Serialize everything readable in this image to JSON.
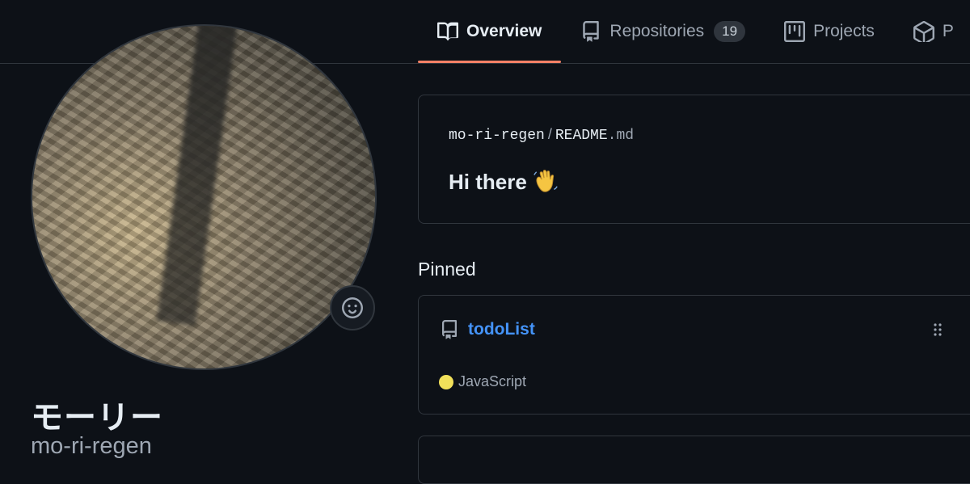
{
  "tabs": {
    "overview": {
      "label": "Overview",
      "icon": "book-icon"
    },
    "repositories": {
      "label": "Repositories",
      "count": "19",
      "icon": "repo-icon"
    },
    "projects": {
      "label": "Projects",
      "icon": "project-icon"
    },
    "packages": {
      "label": "P",
      "icon": "package-icon"
    }
  },
  "profile": {
    "display_name": "モーリー",
    "username": "mo-ri-regen",
    "status_icon": "smiley-icon"
  },
  "readme": {
    "owner": "mo-ri-regen",
    "separator": "/",
    "file_base": "README",
    "file_ext": ".md",
    "heading": "Hi there"
  },
  "pinned": {
    "title": "Pinned",
    "items": [
      {
        "name": "todoList",
        "language": "JavaScript",
        "language_color": "#f1e05a"
      }
    ]
  },
  "colors": {
    "accent_underline": "#f78166",
    "link": "#4493f8",
    "background": "#0d1117"
  }
}
